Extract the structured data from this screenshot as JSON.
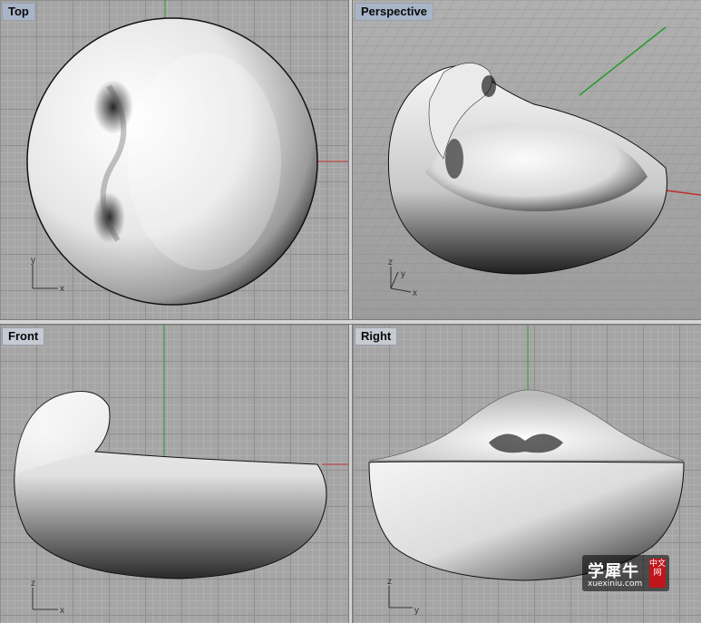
{
  "viewports": {
    "top": {
      "label": "Top",
      "axis1": "y",
      "axis2": "x"
    },
    "perspective": {
      "label": "Perspective",
      "axis1": "z",
      "axis2": "y",
      "axis3": "x"
    },
    "front": {
      "label": "Front",
      "axis1": "z",
      "axis2": "x"
    },
    "right": {
      "label": "Right",
      "axis1": "z",
      "axis2": "y"
    }
  },
  "watermark": {
    "chinese": "学犀牛",
    "badge": "中文网",
    "url": "xuexiniu.com"
  },
  "colors": {
    "grid_bg": "#a5a5a5",
    "x_axis": "#c0302a",
    "y_axis": "#2a9a2a",
    "label_bg": "#c5cad3"
  }
}
